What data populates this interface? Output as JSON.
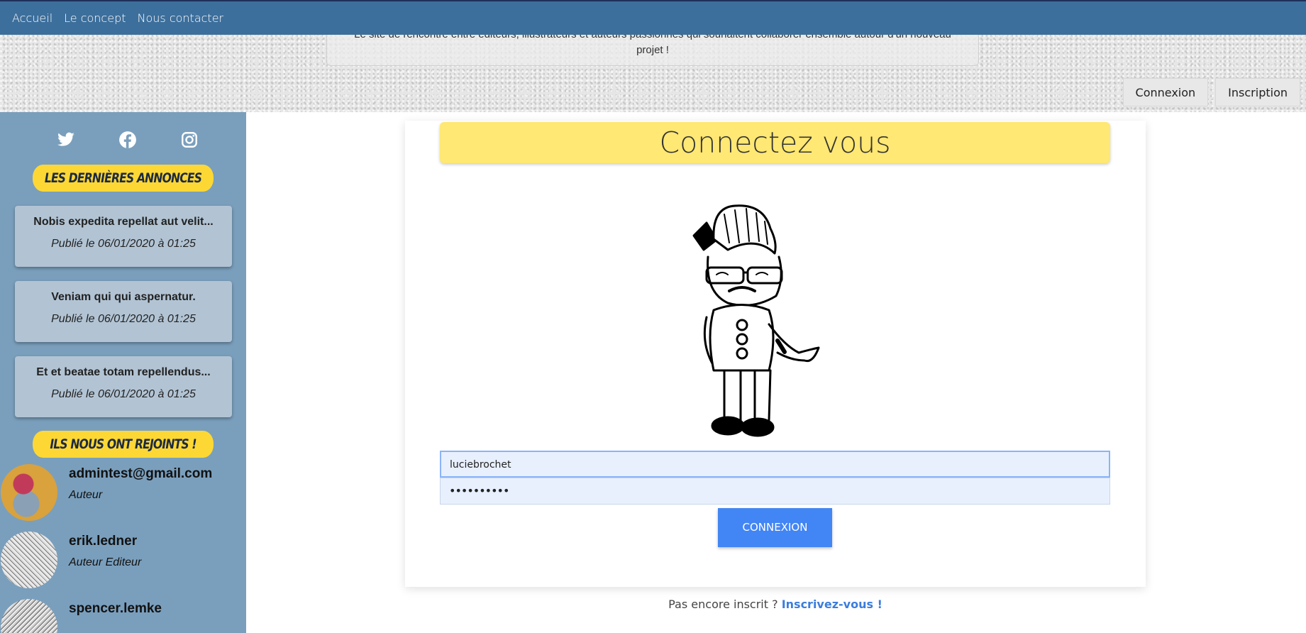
{
  "nav": {
    "items": [
      "Accueil",
      "Le concept",
      "Nous contacter"
    ]
  },
  "header": {
    "tagline_line1": "Le site de rencontre entre éditeurs, illustrateurs et auteurs passionnés qui souhaitent collaborer ensemble autour d'un nouveau",
    "tagline_line2": "projet !",
    "login_label": "Connexion",
    "register_label": "Inscription"
  },
  "sidebar": {
    "social_icons": [
      "twitter-icon",
      "facebook-icon",
      "instagram-icon"
    ],
    "annonces_title": "LES DERNIÈRES ANNONCES",
    "annonces": [
      {
        "title": "Nobis expedita repellat aut velit...",
        "date": "Publié le 06/01/2020 à 01:25"
      },
      {
        "title": "Veniam qui qui aspernatur.",
        "date": "Publié le 06/01/2020 à 01:25"
      },
      {
        "title": "Et et beatae totam repellendus...",
        "date": "Publié le 06/01/2020 à 01:25"
      }
    ],
    "members_title": "ILS NOUS ONT REJOINTS !",
    "members": [
      {
        "name": "admintest@gmail.com",
        "role": "Auteur"
      },
      {
        "name": "erik.ledner",
        "role": "Auteur Editeur"
      },
      {
        "name": "spencer.lemke",
        "role": ""
      }
    ]
  },
  "login": {
    "title": "Connectez vous",
    "username_value": "luciebrochet",
    "password_value": "••••••••••",
    "submit_label": "CONNEXION",
    "signup_text": "Pas encore inscrit ?",
    "signup_link": "Inscrivez-vous !"
  },
  "colors": {
    "nav": "#3d6f9c",
    "sidebar": "#7a9fbd",
    "accent_yellow": "#fdd835",
    "primary_button": "#4285f4"
  }
}
